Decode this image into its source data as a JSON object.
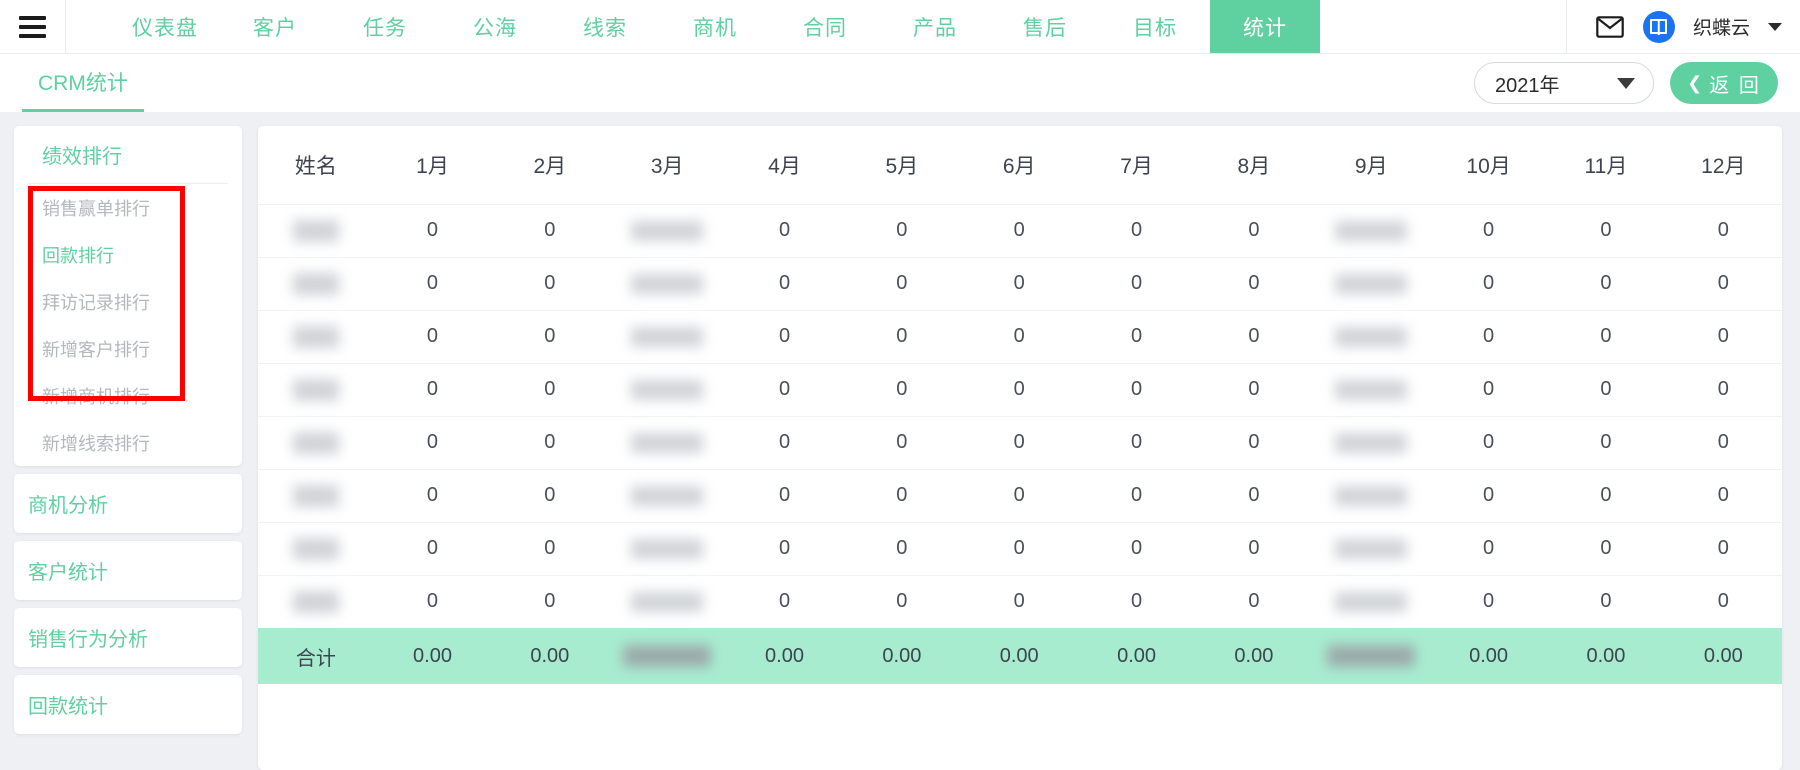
{
  "topnav": {
    "menu_icon": "hamburger-icon",
    "tabs": [
      {
        "label": "仪表盘",
        "active": false
      },
      {
        "label": "客户",
        "active": false
      },
      {
        "label": "任务",
        "active": false
      },
      {
        "label": "公海",
        "active": false
      },
      {
        "label": "线索",
        "active": false
      },
      {
        "label": "商机",
        "active": false
      },
      {
        "label": "合同",
        "active": false
      },
      {
        "label": "产品",
        "active": false
      },
      {
        "label": "售后",
        "active": false
      },
      {
        "label": "目标",
        "active": false
      },
      {
        "label": "统计",
        "active": true
      }
    ],
    "mail_icon": "envelope-icon",
    "avatar_icon": "company-logo-avatar",
    "username": "织蝶云",
    "caret_icon": "chevron-down-icon"
  },
  "subheader": {
    "tab_label": "CRM统计",
    "year_value": "2021年",
    "year_caret_icon": "chevron-down-icon",
    "back_label": "返 回",
    "back_icon": "chevron-left-icon"
  },
  "sidebar": {
    "groups": [
      {
        "title": "绩效排行",
        "items": [
          {
            "label": "销售赢单排行",
            "active": false
          },
          {
            "label": "回款排行",
            "active": true
          },
          {
            "label": "拜访记录排行",
            "active": false
          },
          {
            "label": "新增客户排行",
            "active": false
          },
          {
            "label": "新增商机排行",
            "active": false
          },
          {
            "label": "新增线索排行",
            "active": false
          }
        ]
      }
    ],
    "singles": [
      {
        "label": "商机分析"
      },
      {
        "label": "客户统计"
      },
      {
        "label": "销售行为分析"
      },
      {
        "label": "回款统计"
      }
    ],
    "annotation_color": "#ff0000"
  },
  "table": {
    "columns": [
      "姓名",
      "1月",
      "2月",
      "3月",
      "4月",
      "5月",
      "6月",
      "7月",
      "8月",
      "9月",
      "10月",
      "11月",
      "12月"
    ],
    "redacted_columns": [
      "姓名",
      "3月",
      "9月"
    ],
    "rows": [
      {
        "name": "REDACTED",
        "values": [
          "0",
          "0",
          "REDACTED",
          "0",
          "0",
          "0",
          "0",
          "0",
          "REDACTED",
          "0",
          "0",
          "0"
        ]
      },
      {
        "name": "REDACTED",
        "values": [
          "0",
          "0",
          "REDACTED",
          "0",
          "0",
          "0",
          "0",
          "0",
          "REDACTED",
          "0",
          "0",
          "0"
        ]
      },
      {
        "name": "REDACTED",
        "values": [
          "0",
          "0",
          "REDACTED",
          "0",
          "0",
          "0",
          "0",
          "0",
          "REDACTED",
          "0",
          "0",
          "0"
        ]
      },
      {
        "name": "REDACTED",
        "values": [
          "0",
          "0",
          "REDACTED",
          "0",
          "0",
          "0",
          "0",
          "0",
          "REDACTED",
          "0",
          "0",
          "0"
        ]
      },
      {
        "name": "REDACTED",
        "values": [
          "0",
          "0",
          "REDACTED",
          "0",
          "0",
          "0",
          "0",
          "0",
          "REDACTED",
          "0",
          "0",
          "0"
        ]
      },
      {
        "name": "REDACTED",
        "values": [
          "0",
          "0",
          "REDACTED",
          "0",
          "0",
          "0",
          "0",
          "0",
          "REDACTED",
          "0",
          "0",
          "0"
        ]
      },
      {
        "name": "REDACTED",
        "values": [
          "0",
          "0",
          "REDACTED",
          "0",
          "0",
          "0",
          "0",
          "0",
          "REDACTED",
          "0",
          "0",
          "0"
        ]
      },
      {
        "name": "REDACTED",
        "values": [
          "0",
          "0",
          "REDACTED",
          "0",
          "0",
          "0",
          "0",
          "0",
          "REDACTED",
          "0",
          "0",
          "0"
        ]
      }
    ],
    "total": {
      "label": "合计",
      "values": [
        "0.00",
        "0.00",
        "REDACTED",
        "0.00",
        "0.00",
        "0.00",
        "0.00",
        "0.00",
        "REDACTED",
        "0.00",
        "0.00",
        "0.00"
      ]
    }
  },
  "colors": {
    "accent_green": "#5fd0a0",
    "total_row_green": "#a8ecd0",
    "page_bg": "#eef0f4",
    "annotation_red": "#ff0000",
    "avatar_blue": "#1a73f0"
  }
}
